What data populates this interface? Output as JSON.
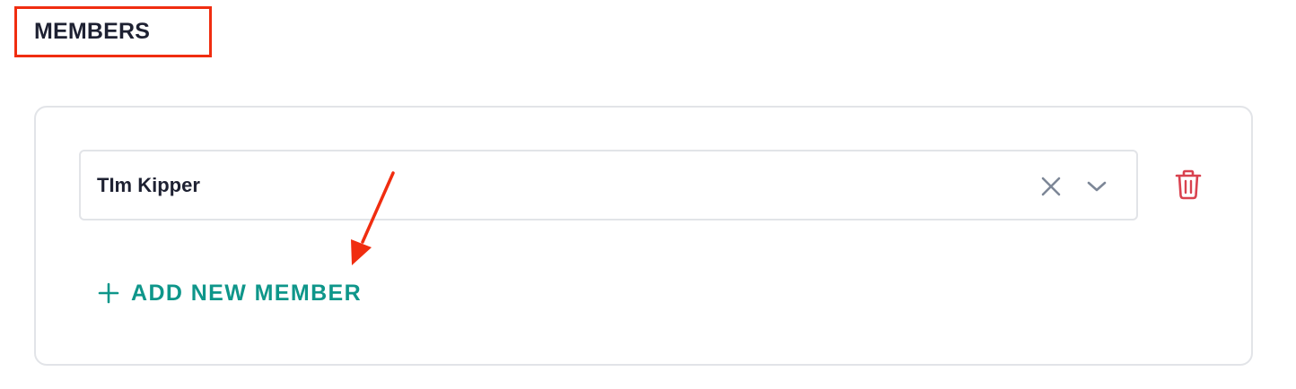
{
  "section": {
    "title": "MEMBERS"
  },
  "members": [
    {
      "name": "TIm Kipper"
    }
  ],
  "add_member": {
    "label": "ADD NEW MEMBER"
  },
  "icons": {
    "clear": "close-icon",
    "dropdown": "chevron-down-icon",
    "delete": "trash-icon",
    "add": "plus-icon"
  },
  "colors": {
    "annotation": "#f02d10",
    "accent": "#0e968a",
    "danger": "#d9424f",
    "icon_gray": "#7d8797",
    "text": "#1e2132",
    "border": "#e2e4e8"
  }
}
